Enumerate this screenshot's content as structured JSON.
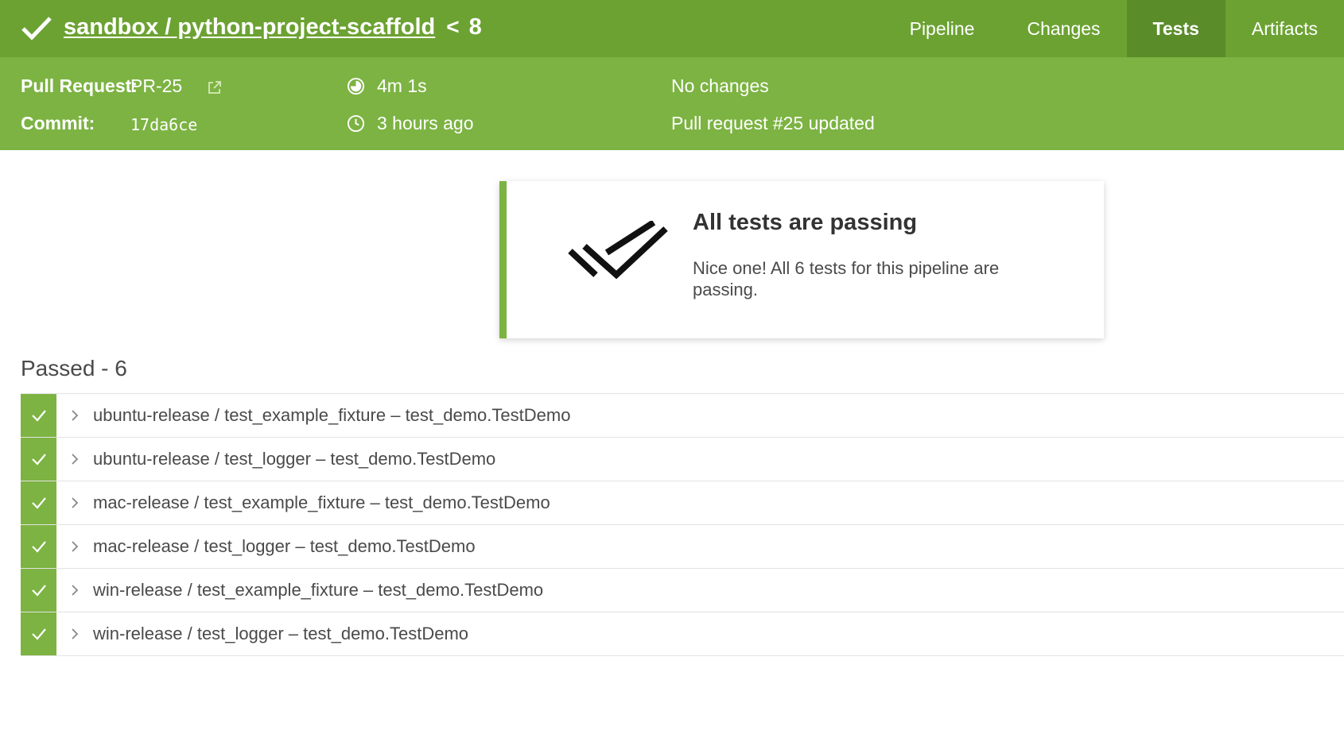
{
  "header": {
    "repo": "sandbox / python-project-scaffold",
    "chevron": "<",
    "run_number": "8",
    "tabs": [
      {
        "label": "Pipeline",
        "active": false
      },
      {
        "label": "Changes",
        "active": false
      },
      {
        "label": "Tests",
        "active": true
      },
      {
        "label": "Artifacts",
        "active": false
      }
    ]
  },
  "meta": {
    "pull_request_label": "Pull Request:",
    "pull_request_value": "PR-25",
    "commit_label": "Commit:",
    "commit_value": "17da6ce",
    "duration": "4m 1s",
    "started": "3 hours ago",
    "changes": "No changes",
    "cause": "Pull request #25 updated"
  },
  "summary": {
    "title": "All tests are passing",
    "text": "Nice one! All 6 tests for this pipeline are passing."
  },
  "results": {
    "section_title": "Passed - 6",
    "rows": [
      {
        "name": "ubuntu-release / test_example_fixture – test_demo.TestDemo"
      },
      {
        "name": "ubuntu-release / test_logger – test_demo.TestDemo"
      },
      {
        "name": "mac-release / test_example_fixture – test_demo.TestDemo"
      },
      {
        "name": "mac-release / test_logger – test_demo.TestDemo"
      },
      {
        "name": "win-release / test_example_fixture – test_demo.TestDemo"
      },
      {
        "name": "win-release / test_logger – test_demo.TestDemo"
      }
    ]
  },
  "colors": {
    "header_bg": "#6ca232",
    "active_tab_bg": "#5b8c2a",
    "meta_bg": "#7cb342",
    "success": "#7cb342"
  },
  "icons": {
    "status": "check-icon",
    "external": "external-link-icon",
    "duration": "pie-clock-icon",
    "time": "clock-icon",
    "summary": "double-check-icon",
    "row_status": "check-icon",
    "row_expand": "chevron-right-icon"
  }
}
